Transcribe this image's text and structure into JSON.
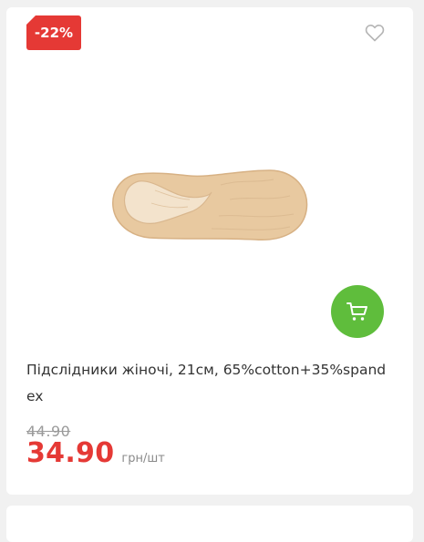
{
  "product": {
    "discount_badge": "-22%",
    "title": "Підслідники жіночі, 21см, 65%cotton+35%spandex",
    "old_price": "44.90",
    "price": "34.90",
    "unit": "грн/шт",
    "image_icon": "foot-sock-liner",
    "wishlist_icon": "heart-outline-icon",
    "cart_icon": "shopping-cart-icon"
  },
  "colors": {
    "discount": "#e53935",
    "price": "#e53935",
    "cart_button": "#5fbd3c"
  }
}
